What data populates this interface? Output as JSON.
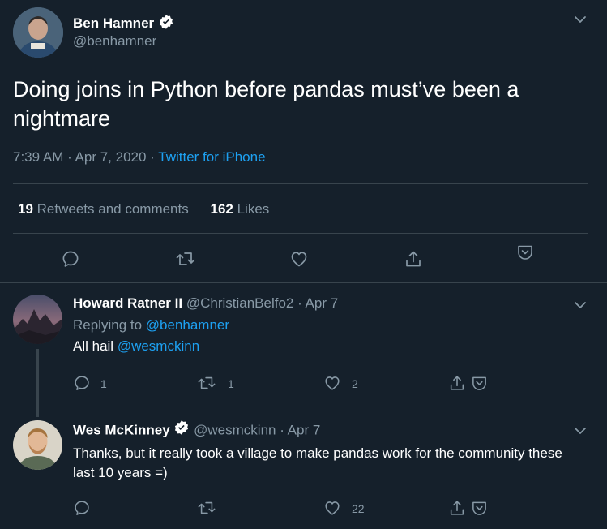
{
  "main_tweet": {
    "author_name": "Ben Hamner",
    "author_handle": "@benhamner",
    "text": "Doing joins in Python before pandas must’ve been a nightmare",
    "time": "7:39 AM · Apr 7, 2020 · ",
    "source": "Twitter for iPhone",
    "retweets_count": "19",
    "retweets_label": "Retweets and comments",
    "likes_count": "162",
    "likes_label": "Likes"
  },
  "reply1": {
    "author_name": "Howard Ratner II",
    "meta": "@ChristianBelfo2 · Apr 7",
    "replying_prefix": "Replying to ",
    "replying_handle": "@benhamner",
    "text_prefix": "All hail ",
    "text_mention": "@wesmckinn",
    "reply_count": "1",
    "retweet_count": "1",
    "like_count": "2"
  },
  "reply2": {
    "author_name": "Wes McKinney",
    "meta": "@wesmckinn · Apr 7",
    "text": "Thanks, but it really took a village to make pandas work for the community these last 10 years =)",
    "like_count": "22"
  },
  "icons": {
    "verified": "verified-badge-icon",
    "chevron": "chevron-down-icon",
    "reply": "reply-icon",
    "retweet": "retweet-icon",
    "like": "heart-icon",
    "share": "share-icon",
    "bookmark": "bookmark-icon"
  },
  "colors": {
    "background": "#15202b",
    "accent": "#1da1f2",
    "muted": "#8899a6",
    "divider": "#38444d"
  }
}
